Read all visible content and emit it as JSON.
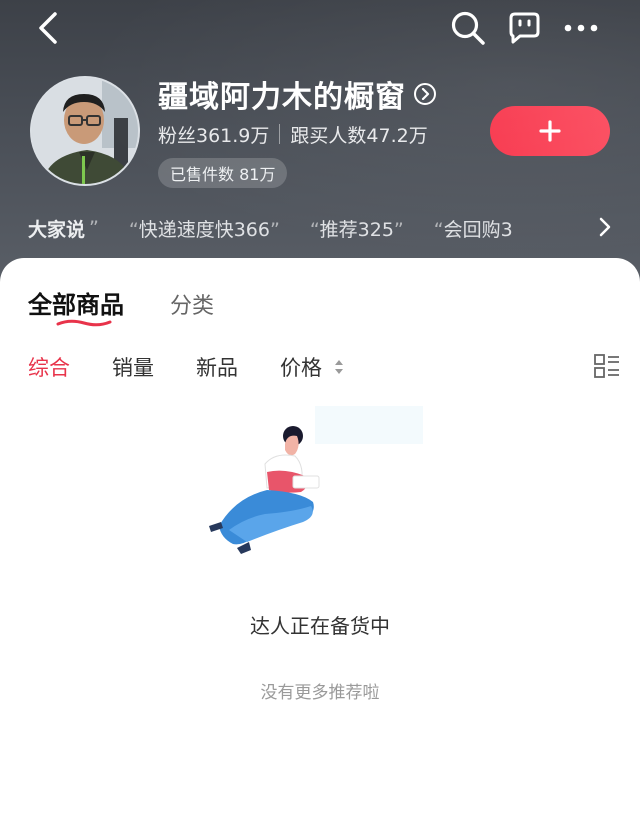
{
  "nav": {
    "back_icon": "chevron-left-icon",
    "search_icon": "search-icon",
    "chat_icon": "message-icon",
    "more_icon": "more-dots-icon"
  },
  "shop": {
    "name": "疆域阿力木的橱窗",
    "fans": "粉丝361.9万",
    "buyers": "跟买人数47.2万",
    "sold": "已售件数 81万",
    "follow_icon": "plus-icon"
  },
  "reviews": {
    "lead": "大家说",
    "items": [
      "快递速度快366",
      "推荐325",
      "会回购3"
    ]
  },
  "tabs": {
    "all": "全部商品",
    "category": "分类"
  },
  "sort": {
    "comprehensive": "综合",
    "sales": "销量",
    "new": "新品",
    "price": "价格"
  },
  "empty": {
    "title": "达人正在备货中",
    "subtitle": "没有更多推荐啦"
  },
  "colors": {
    "accent": "#e8334a",
    "follow": "#f8364c"
  }
}
